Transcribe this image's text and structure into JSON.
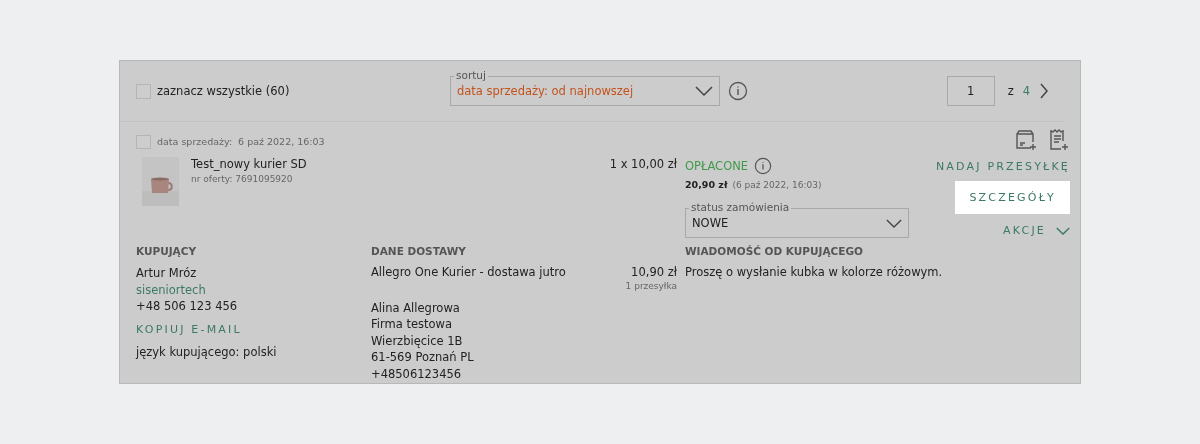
{
  "select_all": {
    "label": "zaznacz wszystkie (60)",
    "checked": false
  },
  "sort": {
    "legend": "sortuj",
    "value": "data sprzedaży: od najnowszej"
  },
  "pagination": {
    "page": "1",
    "separator": "z",
    "total": "4"
  },
  "order": {
    "checked": false,
    "date_label": "data sprzedaży:",
    "date": "6 paź 2022, 16:03",
    "product": {
      "name": "Test_nowy kurier SD",
      "offer": "nr oferty: 7691095920"
    },
    "quantity_price": "1 x 10,00 zł",
    "payment": {
      "status": "OPŁACONE",
      "total": "20,90 zł",
      "date": "(6 paź 2022, 16:03)"
    },
    "order_status": {
      "legend": "status zamówienia",
      "value": "NOWE"
    },
    "actions": [
      {
        "kind": "link",
        "label": "NADAJ PRZESYŁKĘ",
        "highlighted": false
      },
      {
        "kind": "link",
        "label": "SZCZEGÓŁY",
        "highlighted": true
      },
      {
        "kind": "menu",
        "label": "AKCJE",
        "highlighted": false
      }
    ],
    "buyer": {
      "heading": "KUPUJĄCY",
      "name": "Artur Mróz",
      "login": "siseniortech",
      "phone": "+48 506 123 456",
      "copy_email": "KOPIUJ E-MAIL",
      "language": "język kupującego: polski"
    },
    "delivery": {
      "heading": "DANE DOSTAWY",
      "method": "Allegro One Kurier - dostawa jutro",
      "price": "10,90 zł",
      "packages": "1 przesyłka",
      "address": [
        "Alina Allegrowa",
        "Firma testowa",
        "Wierzbięcice 1B",
        "61-569 Poznań PL",
        "+48506123456"
      ]
    },
    "message": {
      "heading": "WIADOMOŚĆ OD KUPUJĄCEGO",
      "text": "Proszę o wysłanie kubka w kolorze różowym."
    }
  }
}
